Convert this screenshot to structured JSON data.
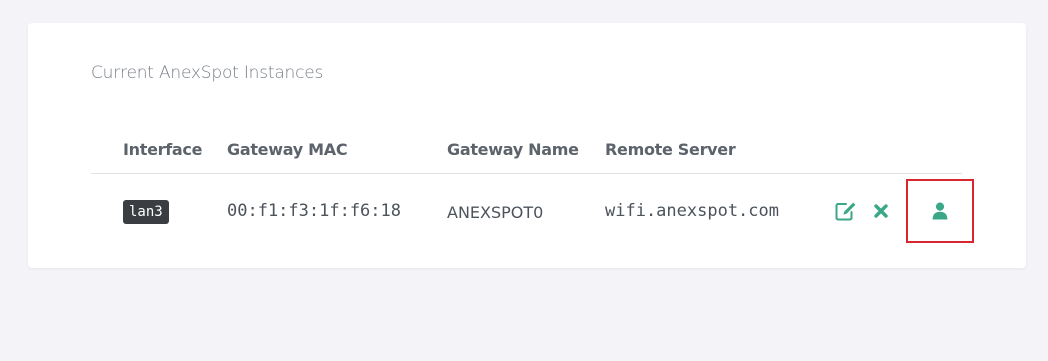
{
  "panel": {
    "title": "Current AnexSpot Instances"
  },
  "table": {
    "columns": [
      "Interface",
      "Gateway MAC",
      "Gateway Name",
      "Remote Server"
    ],
    "rows": [
      {
        "interface": "lan3",
        "gateway_mac": "00:f1:f3:1f:f6:18",
        "gateway_name": "ANEXSPOT0",
        "remote_server": "wifi.anexspot.com",
        "actions": [
          "edit-icon",
          "delete-icon",
          "user-icon"
        ]
      }
    ]
  },
  "colors": {
    "accent": "#3aa786",
    "highlight": "#d9262e",
    "badge_bg": "#3a3d42",
    "page_bg": "#f4f4f8"
  }
}
